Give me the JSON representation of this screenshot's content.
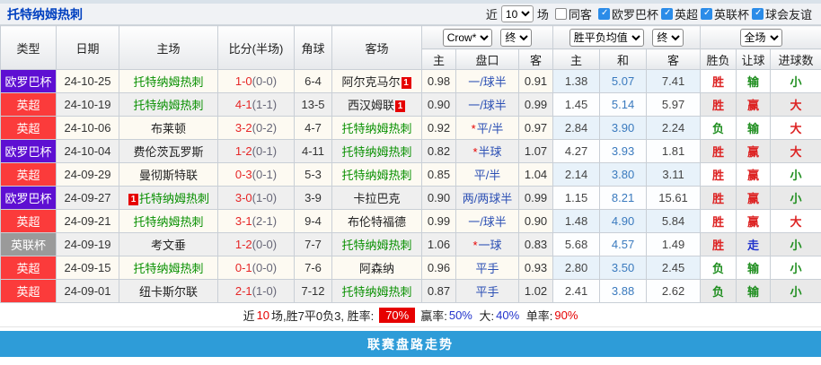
{
  "header": {
    "title": "托特纳姆热刺",
    "near_label": "近",
    "games_count": "10",
    "games_label": "场",
    "same_away_label": "同客",
    "filters": [
      {
        "label": "欧罗巴杯",
        "checked": true
      },
      {
        "label": "英超",
        "checked": true
      },
      {
        "label": "英联杯",
        "checked": true
      },
      {
        "label": "球会友谊",
        "checked": true
      }
    ]
  },
  "table": {
    "self_team": "托特纳姆热刺",
    "columns": {
      "type": "类型",
      "date": "日期",
      "home": "主场",
      "score": "比分(半场)",
      "corner": "角球",
      "away": "客场",
      "odds_home": "主",
      "odds_line": "盘口",
      "odds_away": "客",
      "avg_home": "主",
      "avg_draw": "和",
      "avg_away": "客",
      "result_wl": "胜负",
      "result_handicap": "让球",
      "result_goals": "进球数"
    },
    "selectors": {
      "bookmaker": "Crow*",
      "final1": "终",
      "avg": "胜平负均值",
      "final2": "终",
      "fulltime": "全场"
    },
    "rows": [
      {
        "league": "欧罗巴杯",
        "date": "24-10-25",
        "home": "托特纳姆热刺",
        "home_red": 0,
        "score": "1-0",
        "half": "(0-0)",
        "corners": "6-4",
        "away": "阿尔克马尔",
        "away_red": 1,
        "odds_home": "0.98",
        "line": "一/球半",
        "line_star": false,
        "odds_away": "0.91",
        "avg_home": "1.38",
        "avg_draw": "5.07",
        "avg_away": "7.41",
        "win_loss": "胜",
        "handicap_result": "输",
        "goals_result": "小"
      },
      {
        "league": "英超",
        "date": "24-10-19",
        "home": "托特纳姆热刺",
        "home_red": 0,
        "score": "4-1",
        "half": "(1-1)",
        "corners": "13-5",
        "away": "西汉姆联",
        "away_red": 1,
        "odds_home": "0.90",
        "line": "一/球半",
        "line_star": false,
        "odds_away": "0.99",
        "avg_home": "1.45",
        "avg_draw": "5.14",
        "avg_away": "5.97",
        "win_loss": "胜",
        "handicap_result": "赢",
        "goals_result": "大"
      },
      {
        "league": "英超",
        "date": "24-10-06",
        "home": "布莱顿",
        "home_red": 0,
        "score": "3-2",
        "half": "(0-2)",
        "corners": "4-7",
        "away": "托特纳姆热刺",
        "away_red": 0,
        "odds_home": "0.92",
        "line": "平/半",
        "line_star": true,
        "odds_away": "0.97",
        "avg_home": "2.84",
        "avg_draw": "3.90",
        "avg_away": "2.24",
        "win_loss": "负",
        "handicap_result": "输",
        "goals_result": "大"
      },
      {
        "league": "欧罗巴杯",
        "date": "24-10-04",
        "home": "费伦茨瓦罗斯",
        "home_red": 0,
        "score": "1-2",
        "half": "(0-1)",
        "corners": "4-11",
        "away": "托特纳姆热刺",
        "away_red": 0,
        "odds_home": "0.82",
        "line": "半球",
        "line_star": true,
        "odds_away": "1.07",
        "avg_home": "4.27",
        "avg_draw": "3.93",
        "avg_away": "1.81",
        "win_loss": "胜",
        "handicap_result": "赢",
        "goals_result": "大"
      },
      {
        "league": "英超",
        "date": "24-09-29",
        "home": "曼彻斯特联",
        "home_red": 0,
        "score": "0-3",
        "half": "(0-1)",
        "corners": "5-3",
        "away": "托特纳姆热刺",
        "away_red": 0,
        "odds_home": "0.85",
        "line": "平/半",
        "line_star": false,
        "odds_away": "1.04",
        "avg_home": "2.14",
        "avg_draw": "3.80",
        "avg_away": "3.11",
        "win_loss": "胜",
        "handicap_result": "赢",
        "goals_result": "小"
      },
      {
        "league": "欧罗巴杯",
        "date": "24-09-27",
        "home": "托特纳姆热刺",
        "home_red": 1,
        "score": "3-0",
        "half": "(1-0)",
        "corners": "3-9",
        "away": "卡拉巴克",
        "away_red": 0,
        "odds_home": "0.90",
        "line": "两/两球半",
        "line_star": false,
        "odds_away": "0.99",
        "avg_home": "1.15",
        "avg_draw": "8.21",
        "avg_away": "15.61",
        "win_loss": "胜",
        "handicap_result": "赢",
        "goals_result": "小"
      },
      {
        "league": "英超",
        "date": "24-09-21",
        "home": "托特纳姆热刺",
        "home_red": 0,
        "score": "3-1",
        "half": "(2-1)",
        "corners": "9-4",
        "away": "布伦特福德",
        "away_red": 0,
        "odds_home": "0.99",
        "line": "一/球半",
        "line_star": false,
        "odds_away": "0.90",
        "avg_home": "1.48",
        "avg_draw": "4.90",
        "avg_away": "5.84",
        "win_loss": "胜",
        "handicap_result": "赢",
        "goals_result": "大"
      },
      {
        "league": "英联杯",
        "date": "24-09-19",
        "home": "考文垂",
        "home_red": 0,
        "score": "1-2",
        "half": "(0-0)",
        "corners": "7-7",
        "away": "托特纳姆热刺",
        "away_red": 0,
        "odds_home": "1.06",
        "line": "一球",
        "line_star": true,
        "odds_away": "0.83",
        "avg_home": "5.68",
        "avg_draw": "4.57",
        "avg_away": "1.49",
        "win_loss": "胜",
        "handicap_result": "走",
        "goals_result": "小"
      },
      {
        "league": "英超",
        "date": "24-09-15",
        "home": "托特纳姆热刺",
        "home_red": 0,
        "score": "0-1",
        "half": "(0-0)",
        "corners": "7-6",
        "away": "阿森纳",
        "away_red": 0,
        "odds_home": "0.96",
        "line": "平手",
        "line_star": false,
        "odds_away": "0.93",
        "avg_home": "2.80",
        "avg_draw": "3.50",
        "avg_away": "2.45",
        "win_loss": "负",
        "handicap_result": "输",
        "goals_result": "小"
      },
      {
        "league": "英超",
        "date": "24-09-01",
        "home": "纽卡斯尔联",
        "home_red": 0,
        "score": "2-1",
        "half": "(1-0)",
        "corners": "7-12",
        "away": "托特纳姆热刺",
        "away_red": 0,
        "odds_home": "0.87",
        "line": "平手",
        "line_star": false,
        "odds_away": "1.02",
        "avg_home": "2.41",
        "avg_draw": "3.88",
        "avg_away": "2.62",
        "win_loss": "负",
        "handicap_result": "输",
        "goals_result": "小"
      }
    ]
  },
  "colors": {
    "league": {
      "欧罗巴杯": "#5E0FD2",
      "英超": "#FB3B3B",
      "英联杯": "#9A9A9A"
    },
    "result": {
      "胜": "#DD2222",
      "赢": "#DD2222",
      "大": "#DD2222",
      "负": "#1F8E1F",
      "输": "#1F8E1F",
      "小": "#1F8E1F",
      "走": "#2233CC"
    },
    "accent_blue": "#2E9CD8"
  },
  "summary": {
    "near_label": "近",
    "count": "10",
    "record_text": "场,胜7平0负3, 胜率:",
    "win_rate": "70%",
    "win_odds_label": "赢率:",
    "win_odds": "50%",
    "big_label": "大:",
    "big_rate": "40%",
    "single_label": "单率:",
    "single_rate": "90%"
  },
  "footer": {
    "title": "联赛盘路走势"
  }
}
